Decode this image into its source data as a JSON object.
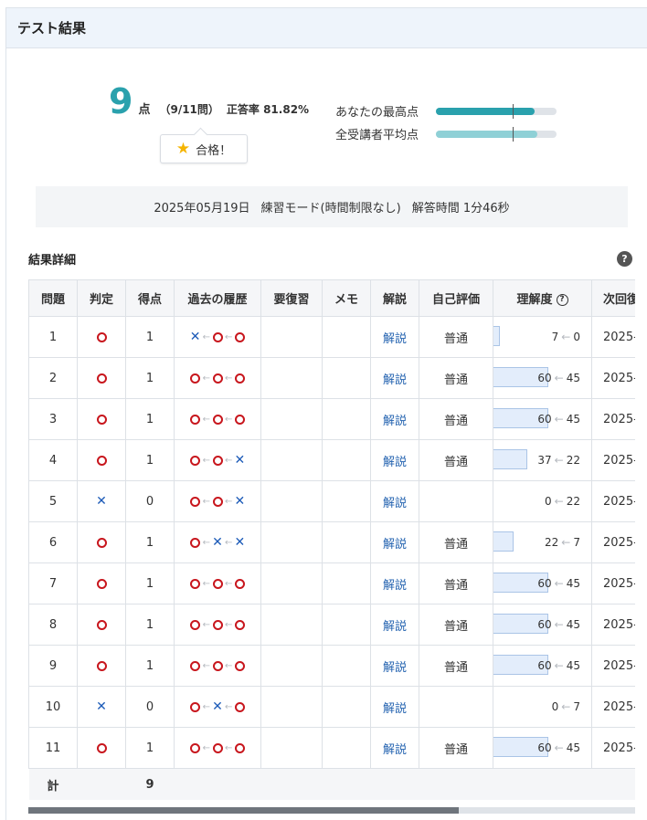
{
  "header": {
    "title": "テスト結果"
  },
  "score": {
    "value": "9",
    "unit": "点",
    "detail": "（9/11問）",
    "rate_label": "正答率 81.82%",
    "pass_label": "合格！",
    "pass_icon": "star-icon"
  },
  "comparison": [
    {
      "label": "あなたの最高点",
      "fill_percent": 82,
      "color": "#2aa1ad"
    },
    {
      "label": "全受講者平均点",
      "fill_percent": 84,
      "color": "#8fd0d6"
    }
  ],
  "info": {
    "date": "2025年05月19日",
    "mode": "練習モード(時間制限なし)",
    "time": "解答時間 1分46秒"
  },
  "details_title": "結果詳細",
  "help_icon": "question-circle-icon",
  "table": {
    "headers": {
      "q": "問題",
      "judge": "判定",
      "score": "得点",
      "history": "過去の履歴",
      "review": "要復習",
      "memo": "メモ",
      "explain": "解説",
      "self_eval": "自己評価",
      "understanding": "理解度",
      "next": "次回復"
    },
    "rows": [
      {
        "q": "1",
        "judge": "o",
        "score": "1",
        "history": [
          "x",
          "o",
          "o"
        ],
        "explain": "解説",
        "self_eval": "普通",
        "und_now": "7",
        "und_prev": "0",
        "und_fill": 7,
        "next": "2025-"
      },
      {
        "q": "2",
        "judge": "o",
        "score": "1",
        "history": [
          "o",
          "o",
          "o"
        ],
        "explain": "解説",
        "self_eval": "普通",
        "und_now": "60",
        "und_prev": "45",
        "und_fill": 60,
        "next": "2025-"
      },
      {
        "q": "3",
        "judge": "o",
        "score": "1",
        "history": [
          "o",
          "o",
          "o"
        ],
        "explain": "解説",
        "self_eval": "普通",
        "und_now": "60",
        "und_prev": "45",
        "und_fill": 60,
        "next": "2025-"
      },
      {
        "q": "4",
        "judge": "o",
        "score": "1",
        "history": [
          "o",
          "o",
          "x"
        ],
        "explain": "解説",
        "self_eval": "普通",
        "und_now": "37",
        "und_prev": "22",
        "und_fill": 37,
        "next": "2025-"
      },
      {
        "q": "5",
        "judge": "x",
        "score": "0",
        "history": [
          "o",
          "o",
          "x"
        ],
        "explain": "解説",
        "self_eval": "",
        "und_now": "0",
        "und_prev": "22",
        "und_fill": 0,
        "next": "2025-"
      },
      {
        "q": "6",
        "judge": "o",
        "score": "1",
        "history": [
          "o",
          "x",
          "x"
        ],
        "explain": "解説",
        "self_eval": "普通",
        "und_now": "22",
        "und_prev": "7",
        "und_fill": 22,
        "next": "2025-"
      },
      {
        "q": "7",
        "judge": "o",
        "score": "1",
        "history": [
          "o",
          "o",
          "o"
        ],
        "explain": "解説",
        "self_eval": "普通",
        "und_now": "60",
        "und_prev": "45",
        "und_fill": 60,
        "next": "2025-"
      },
      {
        "q": "8",
        "judge": "o",
        "score": "1",
        "history": [
          "o",
          "o",
          "o"
        ],
        "explain": "解説",
        "self_eval": "普通",
        "und_now": "60",
        "und_prev": "45",
        "und_fill": 60,
        "next": "2025-"
      },
      {
        "q": "9",
        "judge": "o",
        "score": "1",
        "history": [
          "o",
          "o",
          "o"
        ],
        "explain": "解説",
        "self_eval": "普通",
        "und_now": "60",
        "und_prev": "45",
        "und_fill": 60,
        "next": "2025-"
      },
      {
        "q": "10",
        "judge": "x",
        "score": "0",
        "history": [
          "o",
          "x",
          "o"
        ],
        "explain": "解説",
        "self_eval": "",
        "und_now": "0",
        "und_prev": "7",
        "und_fill": 0,
        "next": "2025-"
      },
      {
        "q": "11",
        "judge": "o",
        "score": "1",
        "history": [
          "o",
          "o",
          "o"
        ],
        "explain": "解説",
        "self_eval": "普通",
        "und_now": "60",
        "und_prev": "45",
        "und_fill": 60,
        "next": "2025-"
      }
    ],
    "total_label": "計",
    "total_score": "9"
  },
  "scroll_percent": 71
}
